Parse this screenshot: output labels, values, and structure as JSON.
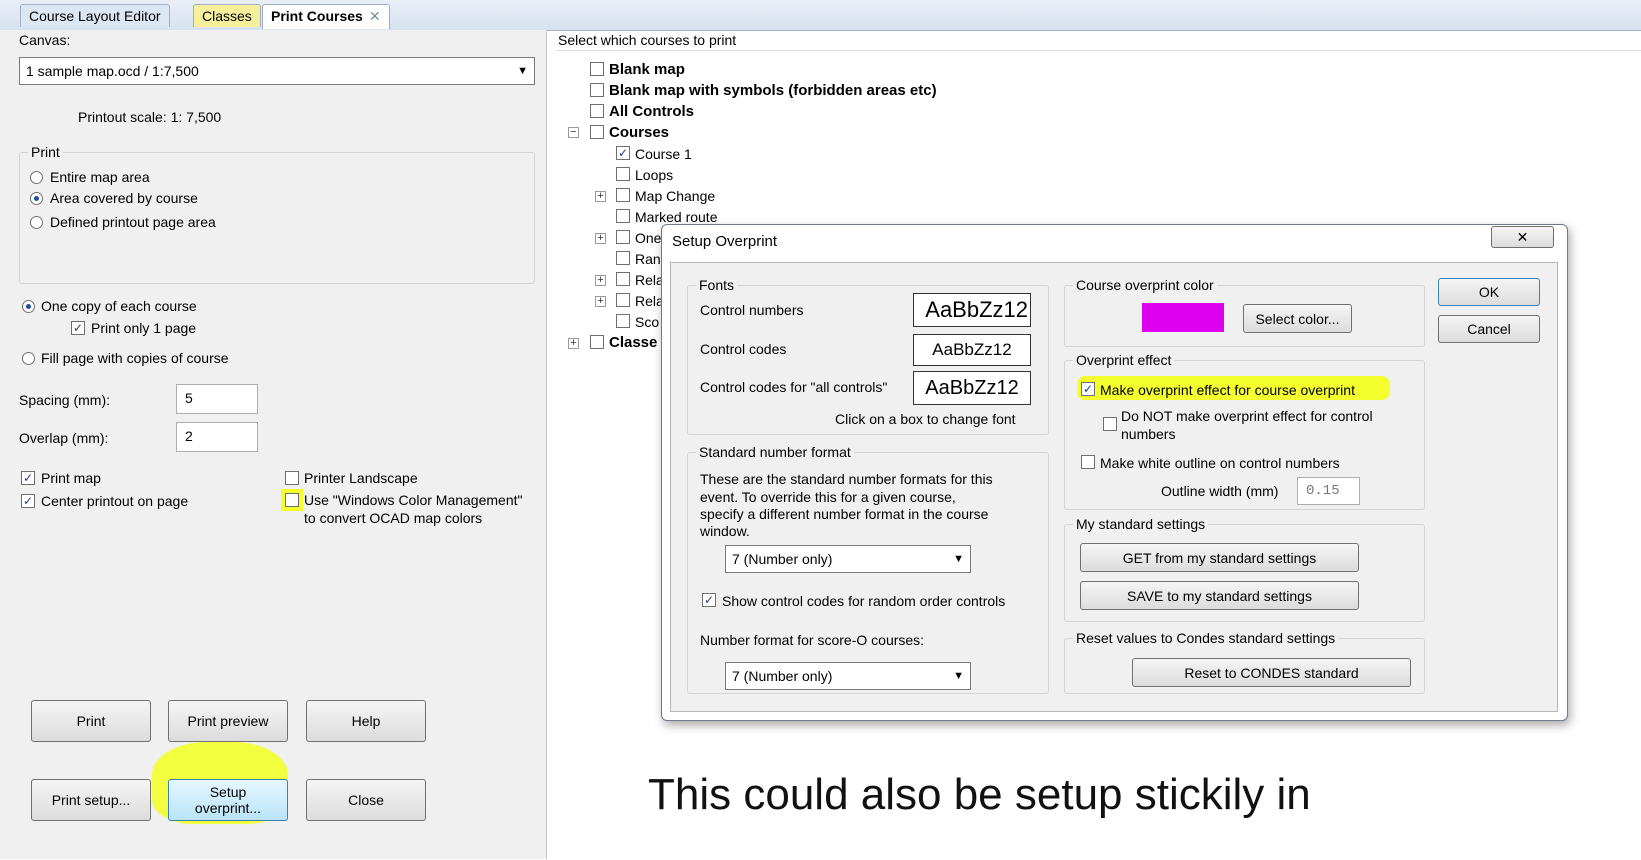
{
  "tabs": [
    {
      "label": "Course Layout Editor"
    },
    {
      "label": "Classes"
    },
    {
      "label": "Print Courses"
    }
  ],
  "left": {
    "canvas_label": "Canvas:",
    "canvas_value": "1 sample map.ocd   / 1:7,500",
    "printout_scale": "Printout scale: 1:  7,500",
    "print_group_title": "Print",
    "print_options": [
      "Entire map area",
      "Area covered by course",
      "Defined printout page area"
    ],
    "one_copy": "One copy of each course",
    "print_only_1_page": "Print only 1 page",
    "fill_page": "Fill page with copies of course",
    "spacing_label": "Spacing (mm):",
    "spacing_value": "5",
    "overlap_label": "Overlap (mm):",
    "overlap_value": "2",
    "print_map": "Print map",
    "center_printout": "Center printout on page",
    "printer_landscape": "Printer Landscape",
    "windows_color_1": "Use \"Windows Color Management\"",
    "windows_color_2": "to convert OCAD map colors",
    "buttons": {
      "print": "Print",
      "print_preview": "Print preview",
      "help": "Help",
      "print_setup": "Print setup...",
      "setup_overprint_1": "Setup",
      "setup_overprint_2": "overprint...",
      "close": "Close"
    }
  },
  "right": {
    "select_label": "Select which courses to print",
    "tree": {
      "blank_map": "Blank map",
      "blank_map_symbols": "Blank map with symbols (forbidden areas etc)",
      "all_controls": "All Controls",
      "courses": "Courses",
      "course_1": "Course 1",
      "loops": "Loops",
      "map_change": "Map Change",
      "marked_route": "Marked route",
      "one": "One",
      "ran": "Ran",
      "rela1": "Rela",
      "rela2": "Rela",
      "sco": "Sco",
      "classes": "Classe"
    }
  },
  "dialog": {
    "title": "Setup Overprint",
    "fonts_title": "Fonts",
    "control_numbers": "Control numbers",
    "control_codes": "Control codes",
    "control_codes_all": "Control codes for \"all controls\"",
    "font_sample": "AaBbZz12",
    "font_sample_cut": "AaBbZz12",
    "click_box": "Click on a box to change font",
    "std_number_title": "Standard number format",
    "std_number_desc_1": "These are the standard number formats for this",
    "std_number_desc_2": "event.  To override this for a given course,",
    "std_number_desc_3": "specify a different number format in the course",
    "std_number_desc_4": "window.",
    "number_format_value": "7  (Number only)",
    "show_control_codes": "Show control codes for random order controls",
    "score_o_label": "Number format for score-O courses:",
    "score_o_value": "7  (Number only)",
    "course_color_title": "Course overprint color",
    "overprint_color": "#dd00ee",
    "select_color": "Select color...",
    "overprint_effect_title": "Overprint effect",
    "make_overprint": "Make overprint effect for course overprint",
    "do_not_overprint_1": "Do NOT make overprint effect for control",
    "do_not_overprint_2": "numbers",
    "white_outline": "Make white outline on control numbers",
    "outline_width_label": "Outline width (mm)",
    "outline_width_value": "0.15",
    "my_std_title": "My standard settings",
    "get_std": "GET from my standard settings",
    "save_std": "SAVE to my standard settings",
    "reset_title": "Reset values to Condes standard settings",
    "reset_btn": "Reset to CONDES standard",
    "ok": "OK",
    "cancel": "Cancel"
  },
  "caption": "This could also be setup stickily in"
}
